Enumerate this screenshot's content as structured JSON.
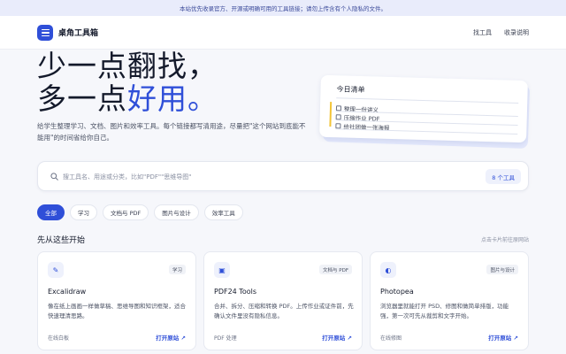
{
  "notice": "本站优先收录官方、开源或明确可用的工具链接；请勿上传含有个人隐私的文件。",
  "header": {
    "brand": "桌角工具箱",
    "nav": [
      "找工具",
      "收录说明"
    ]
  },
  "hero": {
    "line1": "少一点翻找，",
    "line2_prefix": "多一点",
    "line2_accent": "好用。",
    "description": "给学生整理学习、文档、图片和效率工具。每个链接都写清用途，尽量把\"这个网站到底能不能用\"的时间省给你自己。"
  },
  "todo": {
    "title": "今日清单",
    "items": [
      "整理一份讲义",
      "压缩作业 PDF",
      "给社团做一张海报"
    ]
  },
  "search": {
    "placeholder": "搜工具名、用途或分类，比如\"PDF\"\"思维导图\"",
    "value": "",
    "count": "8 个工具"
  },
  "filters": [
    "全部",
    "学习",
    "文档与 PDF",
    "图片与设计",
    "效率工具"
  ],
  "section": {
    "title": "先从这些开始",
    "hint": "点击卡片前往原网站"
  },
  "cards": [
    {
      "icon": "pencil-icon",
      "glyph": "✎",
      "tag": "学习",
      "name": "Excalidraw",
      "desc": "像在纸上画画一样做草稿、思维导图和知识框架，适合快速理清思路。",
      "category": "在线白板",
      "open": "打开原站 ↗"
    },
    {
      "icon": "document-icon",
      "glyph": "▣",
      "tag": "文档与 PDF",
      "name": "PDF24 Tools",
      "desc": "合并、拆分、压缩和转换 PDF。上传作业或证件前，先确认文件里没有隐私信息。",
      "category": "PDF 处理",
      "open": "打开原站 ↗"
    },
    {
      "icon": "contrast-icon",
      "glyph": "◐",
      "tag": "图片与设计",
      "name": "Photopea",
      "desc": "浏览器里就能打开 PSD、修图和做简单排版，功能强，第一次可先从裁剪和文字开始。",
      "category": "在线修图",
      "open": "打开原站 ↗"
    }
  ],
  "colors": {
    "accent": "#2f4fd8",
    "todo_bar": "#f2c437"
  }
}
